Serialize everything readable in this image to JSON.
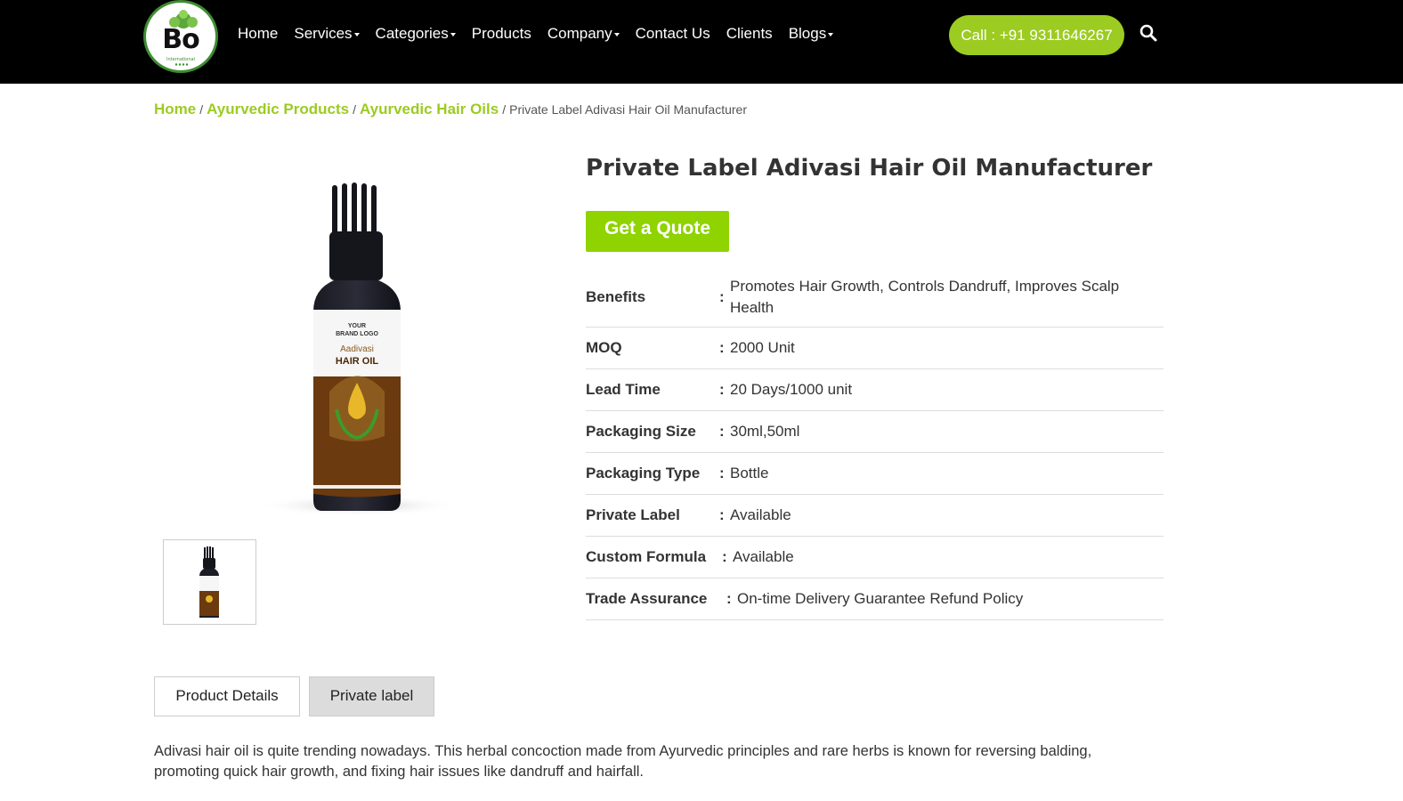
{
  "header": {
    "logo_text": "Bo",
    "logo_sub": "International",
    "nav": [
      {
        "label": "Home",
        "dropdown": false
      },
      {
        "label": "Services",
        "dropdown": true
      },
      {
        "label": "Categories",
        "dropdown": true
      },
      {
        "label": "Products",
        "dropdown": false
      },
      {
        "label": "Company",
        "dropdown": true
      },
      {
        "label": "Contact Us",
        "dropdown": false
      },
      {
        "label": "Clients",
        "dropdown": false
      },
      {
        "label": "Blogs",
        "dropdown": true
      }
    ],
    "call_label": "Call : +91 9311646267",
    "search_icon": "search-icon"
  },
  "breadcrumb": {
    "items": [
      "Home",
      "Ayurvedic Products",
      "Ayurvedic Hair Oils"
    ],
    "separator": "/",
    "current": "Private Label Adivasi Hair Oil Manufacturer"
  },
  "product": {
    "title": "Private Label Adivasi Hair Oil Manufacturer",
    "quote_label": "Get a Quote",
    "image_text": {
      "brand_line1": "YOUR",
      "brand_line2": "BRAND LOGO",
      "name": "Aadivasi",
      "type": "HAIR OIL"
    },
    "specs": [
      {
        "label": "Benefits",
        "value": "Promotes Hair Growth, Controls Dandruff, Improves Scalp Health"
      },
      {
        "label": "MOQ",
        "value": "2000 Unit"
      },
      {
        "label": "Lead Time",
        "value": "20 Days/1000 unit"
      },
      {
        "label": "Packaging Size",
        "value": "30ml,50ml"
      },
      {
        "label": "Packaging Type",
        "value": "Bottle"
      },
      {
        "label": "Private Label",
        "value": "Available"
      },
      {
        "label": "Custom Formula",
        "value": "Available"
      },
      {
        "label": "Trade Assurance",
        "value": "On-time Delivery Guarantee Refund Policy"
      }
    ],
    "colon": ":"
  },
  "tabs": {
    "details": "Product Details",
    "private": "Private label"
  },
  "description": "Adivasi hair oil is quite trending nowadays. This herbal concoction made from Ayurvedic principles and rare herbs is known for reversing balding, promoting quick hair growth, and fixing hair issues like dandruff and hairfall.",
  "colors": {
    "accent": "#9ccb22",
    "quote": "#8fd300",
    "header_bg": "#000000"
  }
}
